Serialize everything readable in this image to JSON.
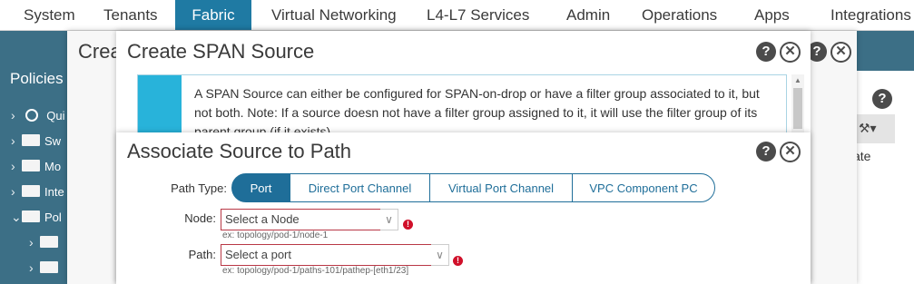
{
  "topnav": {
    "tabs": [
      {
        "label": "System"
      },
      {
        "label": "Tenants"
      },
      {
        "label": "Fabric"
      },
      {
        "label": "Virtual Networking"
      },
      {
        "label": "L4-L7 Services"
      },
      {
        "label": "Admin"
      },
      {
        "label": "Operations"
      },
      {
        "label": "Apps"
      },
      {
        "label": "Integrations"
      }
    ],
    "active": "Fabric"
  },
  "sidebar": {
    "title": "Policies",
    "items": [
      {
        "label": "Qui",
        "icon": "quick-start-icon"
      },
      {
        "label": "Sw",
        "icon": "folder-icon"
      },
      {
        "label": "Mo",
        "icon": "folder-icon"
      },
      {
        "label": "Inte",
        "icon": "folder-icon"
      },
      {
        "label": "Pol",
        "icon": "folder-icon"
      },
      {
        "label": "",
        "icon": "folder-icon"
      },
      {
        "label": "",
        "icon": "folder-icon"
      }
    ]
  },
  "background_dialog": {
    "title": "Crea"
  },
  "right_panel": {
    "partial_text": "ate"
  },
  "span_dialog": {
    "title": "Create SPAN Source",
    "info": "A SPAN Source can either be configured for SPAN-on-drop or have a filter group associated to it, but not both. Note: If a source doesn not have a filter group assigned to it, it will use the filter group of its parent group (if it exists)."
  },
  "assoc_dialog": {
    "title": "Associate Source to Path",
    "path_type": {
      "label": "Path Type:",
      "options": [
        "Port",
        "Direct Port Channel",
        "Virtual Port Channel",
        "VPC Component PC"
      ],
      "selected": "Port"
    },
    "node": {
      "label": "Node:",
      "placeholder": "Select a Node",
      "hint": "ex: topology/pod-1/node-1"
    },
    "path": {
      "label": "Path:",
      "placeholder": "Select a port",
      "hint": "ex: topology/pod-1/paths-101/pathep-[eth1/23]"
    }
  },
  "colors": {
    "accent": "#1f6e99",
    "active_tab": "#1f7aa3",
    "info_bar": "#28b3da",
    "error": "#d0102a",
    "sidebar_bg": "#3c6f86"
  }
}
